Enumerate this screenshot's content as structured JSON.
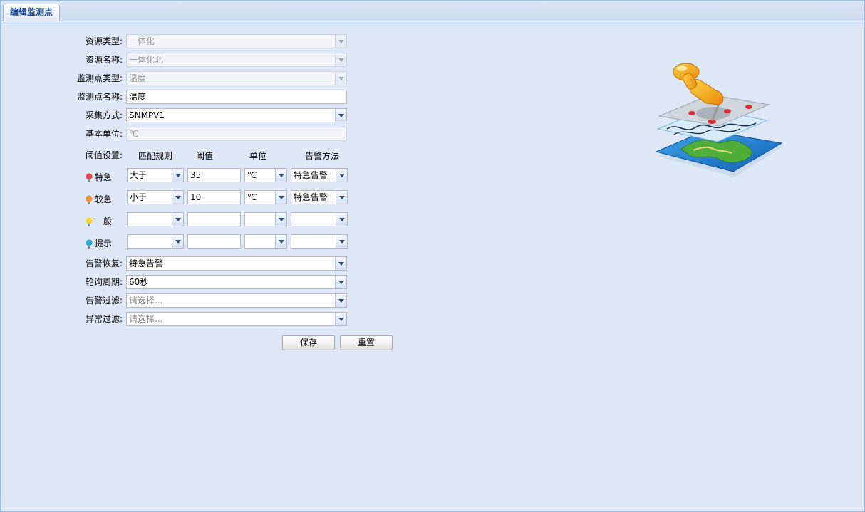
{
  "tab": {
    "label": "编辑监测点"
  },
  "form": {
    "resource_type": {
      "label": "资源类型:",
      "value": "一体化"
    },
    "resource_name": {
      "label": "资源名称:",
      "value": "一体化北"
    },
    "point_type": {
      "label": "监测点类型:",
      "value": "温度"
    },
    "point_name": {
      "label": "监测点名称:",
      "value": "温度"
    },
    "collect_method": {
      "label": "采集方式:",
      "value": "SNMPV1"
    },
    "base_unit": {
      "label": "基本单位:",
      "value": "℃"
    },
    "threshold": {
      "label": "阈值设置:",
      "columns": [
        "匹配规则",
        "阈值",
        "单位",
        "告警方法"
      ],
      "rows": [
        {
          "level": "特急",
          "bulb_color": "#e8414b",
          "rule": "大于",
          "value": "35",
          "unit": "℃",
          "method": "特急告警"
        },
        {
          "level": "较急",
          "bulb_color": "#f0912c",
          "rule": "小于",
          "value": "10",
          "unit": "℃",
          "method": "特急告警"
        },
        {
          "level": "一般",
          "bulb_color": "#f5d327",
          "rule": "",
          "value": "",
          "unit": "",
          "method": ""
        },
        {
          "level": "提示",
          "bulb_color": "#2aa9d6",
          "rule": "",
          "value": "",
          "unit": "",
          "method": ""
        }
      ]
    },
    "alarm_recovery": {
      "label": "告警恢复:",
      "value": "特急告警"
    },
    "poll_cycle": {
      "label": "轮询周期:",
      "value": "60秒"
    },
    "alarm_filter": {
      "label": "告警过滤:",
      "placeholder": "请选择..."
    },
    "exception_filter": {
      "label": "异常过滤:",
      "placeholder": "请选择..."
    }
  },
  "buttons": {
    "save": "保存",
    "reset": "重置"
  },
  "icons": {
    "illustration": "map-pin-layers-icon",
    "bulb": "lightbulb-icon",
    "dropdown": "chevron-down-icon"
  }
}
